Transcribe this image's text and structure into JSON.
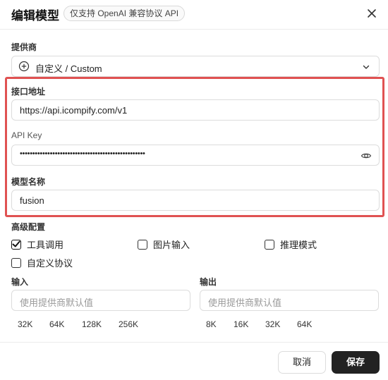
{
  "dialog": {
    "title": "编辑模型",
    "badge": "仅支持 OpenAI 兼容协议 API",
    "close_icon": "close-icon"
  },
  "provider": {
    "label": "提供商",
    "value": "自定义 / Custom",
    "icon": "plus-circle-icon"
  },
  "endpoint": {
    "label": "接口地址",
    "value": "https://api.icompify.com/v1"
  },
  "api_key": {
    "label": "API Key",
    "masked_value": "••••••••••••••••••••••••••••••••••••••••••••••••••",
    "icon": "eye-icon"
  },
  "model_name": {
    "label": "模型名称",
    "value": "fusion"
  },
  "advanced": {
    "label": "高级配置",
    "options": [
      {
        "label": "工具调用",
        "checked": true
      },
      {
        "label": "图片输入",
        "checked": false
      },
      {
        "label": "推理模式",
        "checked": false
      },
      {
        "label": "自定义协议",
        "checked": false
      }
    ]
  },
  "input_ctx": {
    "label": "输入",
    "placeholder": "使用提供商默认值",
    "presets": [
      "32K",
      "64K",
      "128K",
      "256K"
    ]
  },
  "output_ctx": {
    "label": "输出",
    "placeholder": "使用提供商默认值",
    "presets": [
      "8K",
      "16K",
      "32K",
      "64K"
    ]
  },
  "footer": {
    "cancel_label": "取消",
    "save_label": "保存"
  },
  "colors": {
    "highlight": "#e05252",
    "primary_button": "#222222"
  }
}
